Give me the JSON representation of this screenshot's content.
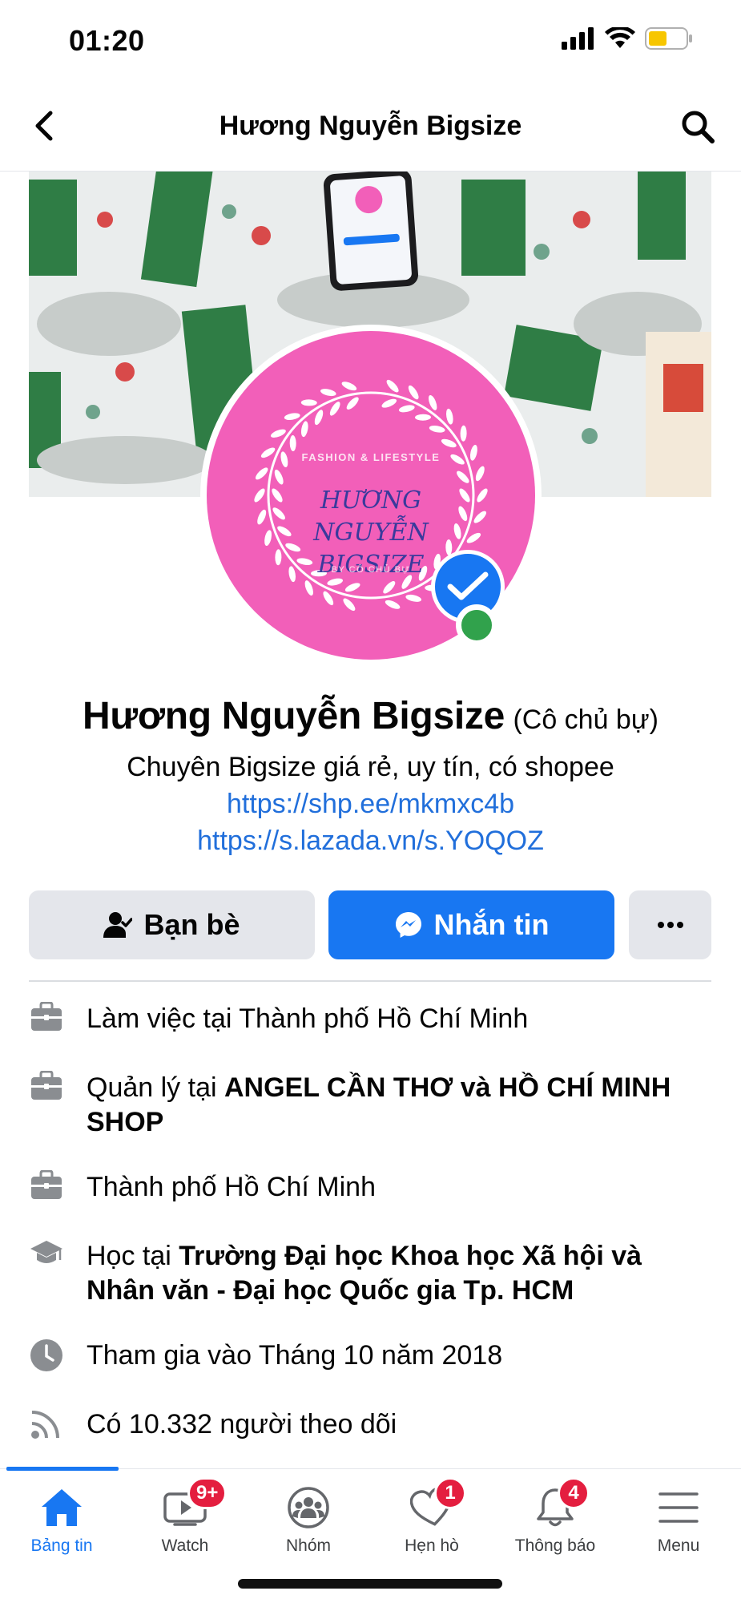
{
  "status": {
    "time": "01:20"
  },
  "header": {
    "title": "Hương Nguyễn Bigsize"
  },
  "avatar": {
    "top_text": "FASHION & LIFESTYLE",
    "name_text": "HƯƠNG NGUYỄN BIGSIZE",
    "bottom_text": "BY CÔ CHỦ BỰ"
  },
  "profile": {
    "name": "Hương Nguyễn Bigsize",
    "alt_name": "(Cô chủ bự)",
    "bio": "Chuyên Bigsize giá rẻ, uy tín, có shopee",
    "link1": "https://shp.ee/mkmxc4b",
    "link2": "https://s.lazada.vn/s.YOQOZ"
  },
  "actions": {
    "friends_label": "Bạn bè",
    "message_label": "Nhắn tin"
  },
  "details": [
    {
      "icon": "briefcase-icon",
      "prefix": "Làm việc tại Thành phố Hồ Chí Minh",
      "bold": ""
    },
    {
      "icon": "briefcase-icon",
      "prefix": "Quản lý tại ",
      "bold": "ANGEL CẦN THƠ và HỒ CHÍ MINH SHOP"
    },
    {
      "icon": "briefcase-icon",
      "prefix": "Thành phố Hồ Chí Minh",
      "bold": ""
    },
    {
      "icon": "graduation-cap-icon",
      "prefix": "Học tại ",
      "bold": "Trường Đại học Khoa học Xã hội và Nhân văn - Đại học Quốc gia Tp. HCM"
    },
    {
      "icon": "clock-icon",
      "prefix": "Tham gia vào Tháng 10 năm 2018",
      "bold": ""
    },
    {
      "icon": "rss-icon",
      "prefix": "Có 10.332 người theo dõi",
      "bold": ""
    }
  ],
  "tabs": [
    {
      "label": "Bảng tin",
      "icon": "home-icon",
      "active": true,
      "badge": ""
    },
    {
      "label": "Watch",
      "icon": "watch-video-icon",
      "active": false,
      "badge": "9+"
    },
    {
      "label": "Nhóm",
      "icon": "groups-icon",
      "active": false,
      "badge": ""
    },
    {
      "label": "Hẹn hò",
      "icon": "dating-heart-icon",
      "active": false,
      "badge": "1"
    },
    {
      "label": "Thông báo",
      "icon": "bell-icon",
      "active": false,
      "badge": "4"
    },
    {
      "label": "Menu",
      "icon": "hamburger-menu-icon",
      "active": false,
      "badge": ""
    }
  ],
  "colors": {
    "primary": "#1877f2",
    "link": "#216fdb",
    "badge": "#e41e3f",
    "online": "#31a24c",
    "avatar_bg": "#f25fb9"
  }
}
